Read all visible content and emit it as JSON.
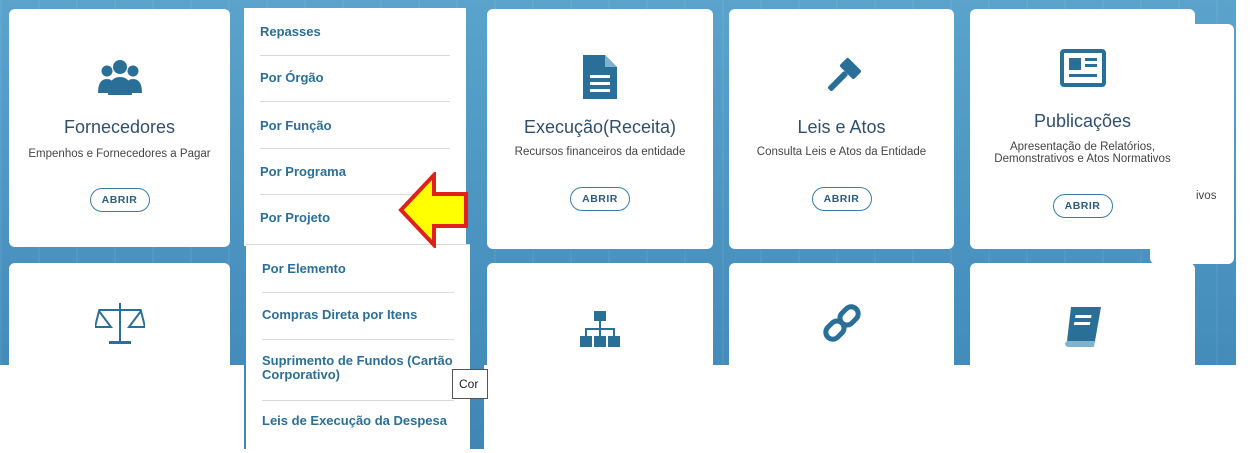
{
  "cards": {
    "fornecedores": {
      "title": "Fornecedores",
      "desc": "Empenhos e Fornecedores a Pagar",
      "button": "ABRIR",
      "icon": "users-icon"
    },
    "execucao": {
      "title": "Execução(Receita)",
      "desc": "Recursos financeiros da entidade",
      "button": "ABRIR",
      "icon": "document-icon"
    },
    "leis": {
      "title": "Leis e Atos",
      "desc": "Consulta Leis e Atos da Entidade",
      "button": "ABRIR",
      "icon": "gavel-icon"
    },
    "publicacoes": {
      "title": "Publicações",
      "desc": "Apresentação de Relatórios, Demonstrativos e Atos Normativos",
      "button": "ABRIR",
      "icon": "newspaper-icon"
    },
    "partial_right_text": "ivos",
    "row2_icons": [
      "scales-icon",
      "sitemap-icon",
      "link-icon",
      "book-icon"
    ]
  },
  "menu": {
    "items": [
      "Repasses",
      "Por Órgão",
      "Por Função",
      "Por Programa",
      "Por Projeto"
    ],
    "lower_items": [
      "Por Elemento",
      "Compras Direta por Itens",
      "Suprimento de Fundos (Cartão Corporativo)",
      "Leis de Execução da Despesa"
    ]
  },
  "tooltip": {
    "text": "Cor"
  },
  "annotation": {
    "arrow_color": "#ffff00",
    "arrow_border": "#e0201a"
  }
}
